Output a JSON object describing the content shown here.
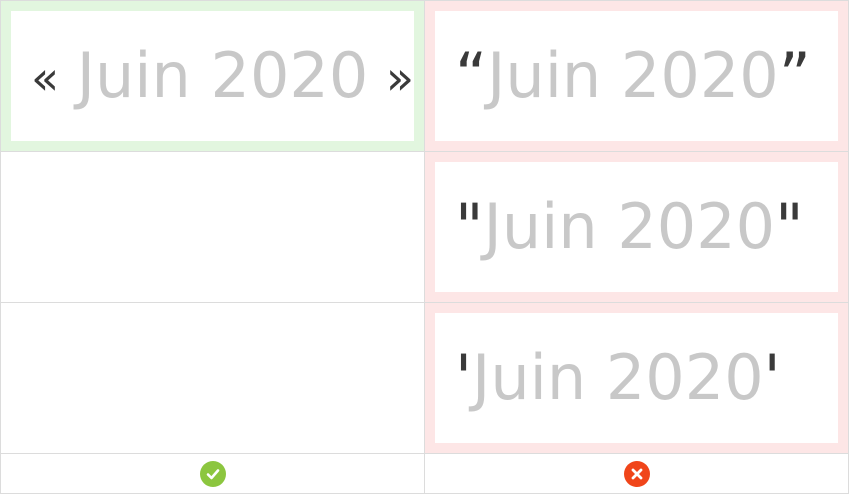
{
  "correct": {
    "open_mark": "«",
    "text": "Juin 2020",
    "close_mark": "»"
  },
  "incorrect": [
    {
      "open_mark": "“",
      "text": "Juin 2020",
      "close_mark": "”"
    },
    {
      "open_mark": "\"",
      "text": "Juin 2020",
      "close_mark": "\""
    },
    {
      "open_mark": "'",
      "text": "Juin 2020",
      "close_mark": "'"
    }
  ],
  "status": {
    "correct_icon": "check-circle-icon",
    "correct_color": "#8cc63f",
    "incorrect_icon": "close-circle-icon",
    "incorrect_color": "#f0451a"
  },
  "colors": {
    "good_frame": "#e2f6df",
    "bad_frame": "#fde6e6",
    "quote_mark": "#3a3a3a",
    "word": "#c8c8c8",
    "grid_line": "#dcdcdc"
  }
}
